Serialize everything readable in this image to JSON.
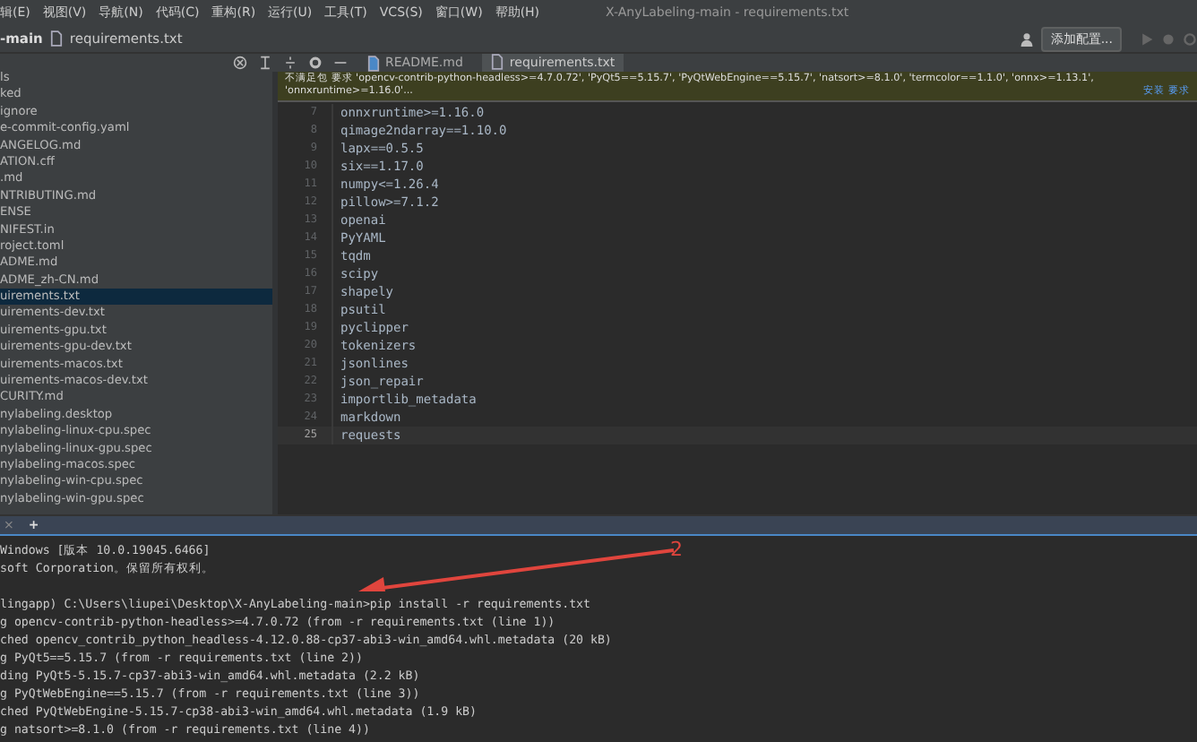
{
  "menu": [
    "辑(E)",
    "视图(V)",
    "导航(N)",
    "代码(C)",
    "重构(R)",
    "运行(U)",
    "工具(T)",
    "VCS(S)",
    "窗口(W)",
    "帮助(H)"
  ],
  "window": {
    "title": "X-AnyLabeling-main - requirements.txt"
  },
  "breadcrumb": {
    "project": "-main",
    "file": "requirements.txt"
  },
  "toolbar": {
    "config_button": "添加配置..."
  },
  "tabs": [
    {
      "label": "README.md",
      "selected": false
    },
    {
      "label": "requirements.txt",
      "selected": true
    }
  ],
  "sidebar": {
    "items": [
      {
        "label": "ls",
        "selected": false
      },
      {
        "label": "ked",
        "selected": false
      },
      {
        "label": "ignore",
        "selected": false
      },
      {
        "label": "e-commit-config.yaml",
        "selected": false
      },
      {
        "label": "ANGELOG.md",
        "selected": false
      },
      {
        "label": "ATION.cff",
        "selected": false
      },
      {
        "label": ".md",
        "selected": false
      },
      {
        "label": "NTRIBUTING.md",
        "selected": false
      },
      {
        "label": "ENSE",
        "selected": false
      },
      {
        "label": "NIFEST.in",
        "selected": false
      },
      {
        "label": "roject.toml",
        "selected": false
      },
      {
        "label": "ADME.md",
        "selected": false
      },
      {
        "label": "ADME_zh-CN.md",
        "selected": false
      },
      {
        "label": "uirements.txt",
        "selected": true
      },
      {
        "label": "uirements-dev.txt",
        "selected": false
      },
      {
        "label": "uirements-gpu.txt",
        "selected": false
      },
      {
        "label": "uirements-gpu-dev.txt",
        "selected": false
      },
      {
        "label": "uirements-macos.txt",
        "selected": false
      },
      {
        "label": "uirements-macos-dev.txt",
        "selected": false
      },
      {
        "label": "CURITY.md",
        "selected": false
      },
      {
        "label": "nylabeling.desktop",
        "selected": false
      },
      {
        "label": "nylabeling-linux-cpu.spec",
        "selected": false
      },
      {
        "label": "nylabeling-linux-gpu.spec",
        "selected": false
      },
      {
        "label": "nylabeling-macos.spec",
        "selected": false
      },
      {
        "label": "nylabeling-win-cpu.spec",
        "selected": false
      },
      {
        "label": "nylabeling-win-gpu.spec",
        "selected": false
      }
    ]
  },
  "banner": {
    "text": "不满足包 要求 'opencv-contrib-python-headless>=4.7.0.72', 'PyQt5==5.15.7', 'PyQtWebEngine==5.15.7', 'natsort>=8.1.0', 'termcolor==1.1.0', 'onnx>=1.13.1', 'onnxruntime>=1.16.0'...",
    "link": "安装 要求"
  },
  "editor": {
    "lines": [
      {
        "number": "7",
        "code": "onnxruntime>=1.16.0",
        "current": false
      },
      {
        "number": "8",
        "code": "qimage2ndarray==1.10.0",
        "current": false
      },
      {
        "number": "9",
        "code": "lapx==0.5.5",
        "current": false
      },
      {
        "number": "10",
        "code": "six==1.17.0",
        "current": false
      },
      {
        "number": "11",
        "code": "numpy<=1.26.4",
        "current": false
      },
      {
        "number": "12",
        "code": "pillow>=7.1.2",
        "current": false
      },
      {
        "number": "13",
        "code": "openai",
        "current": false
      },
      {
        "number": "14",
        "code": "PyYAML",
        "current": false
      },
      {
        "number": "15",
        "code": "tqdm",
        "current": false
      },
      {
        "number": "16",
        "code": "scipy",
        "current": false
      },
      {
        "number": "17",
        "code": "shapely",
        "current": false
      },
      {
        "number": "18",
        "code": "psutil",
        "current": false
      },
      {
        "number": "19",
        "code": "pyclipper",
        "current": false
      },
      {
        "number": "20",
        "code": "tokenizers",
        "current": false
      },
      {
        "number": "21",
        "code": "jsonlines",
        "current": false
      },
      {
        "number": "22",
        "code": "json_repair",
        "current": false
      },
      {
        "number": "23",
        "code": "importlib_metadata",
        "current": false
      },
      {
        "number": "24",
        "code": "markdown",
        "current": false
      },
      {
        "number": "25",
        "code": "requests",
        "current": true
      }
    ]
  },
  "terminal": {
    "new_tab": "+",
    "close_tab": "×",
    "lines": [
      "Windows [版本 10.0.19045.6466]",
      "soft Corporation。保留所有权利。",
      "lingapp) C:\\Users\\liupei\\Desktop\\X-AnyLabeling-main>pip install -r requirements.txt",
      "g opencv-contrib-python-headless>=4.7.0.72 (from -r requirements.txt (line 1))",
      "ched opencv_contrib_python_headless-4.12.0.88-cp37-abi3-win_amd64.whl.metadata (20 kB)",
      "g PyQt5==5.15.7 (from -r requirements.txt (line 2))",
      "ding PyQt5-5.15.7-cp37-abi3-win_amd64.whl.metadata (2.2 kB)",
      "g PyQtWebEngine==5.15.7 (from -r requirements.txt (line 3))",
      "ched PyQtWebEngine-5.15.7-cp38-abi3-win_amd64.whl.metadata (1.9 kB)",
      "g natsort>=8.1.0 (from -r requirements.txt (line 4))"
    ]
  },
  "annotation": {
    "label": "2"
  }
}
